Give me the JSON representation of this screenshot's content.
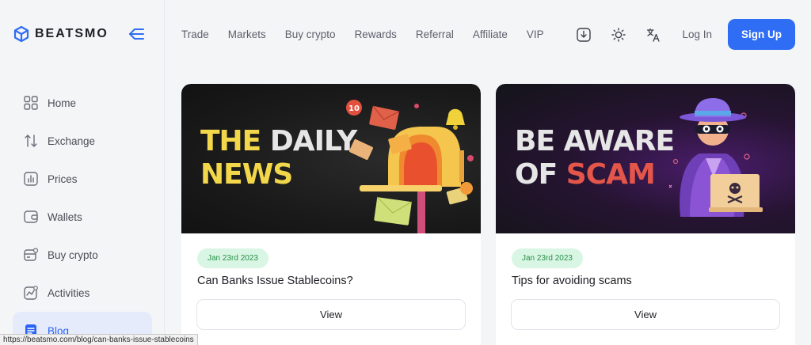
{
  "app": {
    "name": "BEATSMO"
  },
  "sidebar": {
    "items": [
      {
        "label": "Home",
        "icon": "grid-icon"
      },
      {
        "label": "Exchange",
        "icon": "arrows-updown-icon"
      },
      {
        "label": "Prices",
        "icon": "bar-chart-icon"
      },
      {
        "label": "Wallets",
        "icon": "wallet-icon"
      },
      {
        "label": "Buy crypto",
        "icon": "card-icon"
      },
      {
        "label": "Activities",
        "icon": "activity-icon"
      },
      {
        "label": "Blog",
        "icon": "document-icon",
        "active": true
      }
    ]
  },
  "topnav": [
    "Trade",
    "Markets",
    "Buy crypto",
    "Rewards",
    "Referral",
    "Affiliate",
    "VIP"
  ],
  "actions": {
    "login": "Log In",
    "signup": "Sign Up"
  },
  "posts": [
    {
      "banner_line1_a": "THE",
      "banner_line1_b": "DAILY",
      "banner_line2": "NEWS",
      "date": "Jan 23rd 2023",
      "title": "Can Banks Issue Stablecoins?",
      "view": "View",
      "badge_number": "10"
    },
    {
      "banner_line1": "BE AWARE",
      "banner_line2_a": "OF",
      "banner_line2_b": "SCAM",
      "date": "Jan 23rd 2023",
      "title": "Tips for avoiding scams",
      "view": "View"
    }
  ],
  "status_url": "https://beatsmo.com/blog/can-banks-issue-stablecoins",
  "colors": {
    "accent": "#2f6df5",
    "badge_bg": "#d9f5e3",
    "badge_text": "#27924a"
  }
}
